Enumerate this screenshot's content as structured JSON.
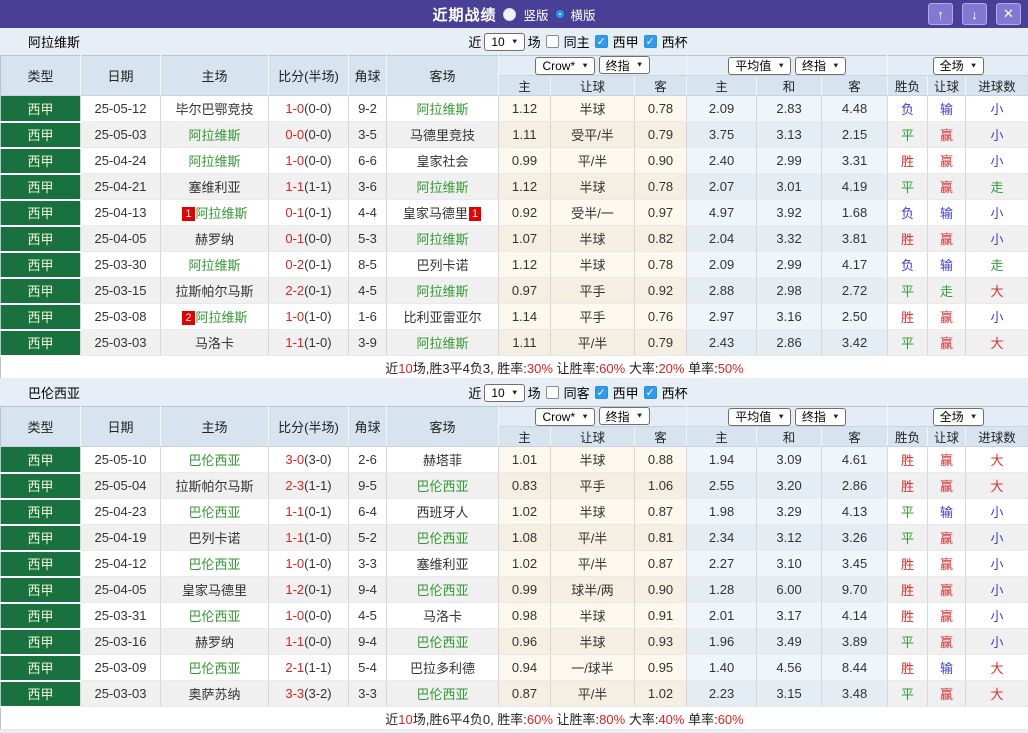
{
  "colors": {
    "titlebar_bg": "#4a3f96",
    "window_button_bg": "#8478d2",
    "league_cell_green": "#18713e",
    "team_link_green": "#339933",
    "score_red": "#dd2222",
    "result_win_red": "#d93030",
    "result_draw_green": "#2f9e36",
    "result_lose_blue": "#3d3dd1",
    "checkbox_checked_blue": "#2d9ced",
    "header_bg": "#d8e3f0"
  },
  "icons": {
    "up": "↑",
    "down": "↓",
    "close": "✕",
    "caret": "▼"
  },
  "titlebar": {
    "title": "近期战绩",
    "radio_vertical": "竖版",
    "radio_vertical_state": "filled",
    "radio_horizontal": "横版",
    "radio_horizontal_state": "ring"
  },
  "table_header": {
    "cols": [
      "类型",
      "日期",
      "主场",
      "比分(半场)",
      "角球",
      "客场"
    ],
    "sub": [
      "主",
      "让球",
      "客",
      "主",
      "和",
      "客",
      "胜负",
      "让球",
      "进球数"
    ]
  },
  "sections": [
    {
      "team": "阿拉维斯",
      "filter": {
        "near_label": "近",
        "count": "10",
        "games_label": "场",
        "same_label": "同主",
        "same_state": "unchecked",
        "league_label": "西甲",
        "league_state": "checked",
        "cup_label": "西杯",
        "cup_state": "checked"
      },
      "dropdowns": {
        "asian_source": "Crow*",
        "asian_kind": "终指",
        "euro_source": "平均值",
        "euro_kind": "终指",
        "scope": "全场"
      },
      "rows": [
        {
          "league": "西甲",
          "date": "25-05-12",
          "home": "毕尔巴鄂竞技",
          "home_cls": "",
          "home_badge": "",
          "ft": "1-0",
          "ht": "(0-0)",
          "corner": "9-2",
          "away": "阿拉维斯",
          "away_cls": "team-green",
          "away_badge": "",
          "ah_home": "1.12",
          "ah_line": "半球",
          "ah_away": "0.78",
          "eu_home": "2.09",
          "eu_draw": "2.83",
          "eu_away": "4.48",
          "r1": "负",
          "r1c": "c-blue",
          "r2": "输",
          "r2c": "c-blue",
          "r3": "小",
          "r3c": "c-blue"
        },
        {
          "league": "西甲",
          "date": "25-05-03",
          "home": "阿拉维斯",
          "home_cls": "team-green",
          "home_badge": "",
          "ft": "0-0",
          "ht": "(0-0)",
          "corner": "3-5",
          "away": "马德里竞技",
          "away_cls": "",
          "away_badge": "",
          "ah_home": "1.11",
          "ah_line": "受平/半",
          "ah_away": "0.79",
          "eu_home": "3.75",
          "eu_draw": "3.13",
          "eu_away": "2.15",
          "r1": "平",
          "r1c": "c-green",
          "r2": "赢",
          "r2c": "c-red",
          "r3": "小",
          "r3c": "c-blue"
        },
        {
          "league": "西甲",
          "date": "25-04-24",
          "home": "阿拉维斯",
          "home_cls": "team-green",
          "home_badge": "",
          "ft": "1-0",
          "ht": "(0-0)",
          "corner": "6-6",
          "away": "皇家社会",
          "away_cls": "",
          "away_badge": "",
          "ah_home": "0.99",
          "ah_line": "平/半",
          "ah_away": "0.90",
          "eu_home": "2.40",
          "eu_draw": "2.99",
          "eu_away": "3.31",
          "r1": "胜",
          "r1c": "c-red",
          "r2": "赢",
          "r2c": "c-red",
          "r3": "小",
          "r3c": "c-blue"
        },
        {
          "league": "西甲",
          "date": "25-04-21",
          "home": "塞维利亚",
          "home_cls": "",
          "home_badge": "",
          "ft": "1-1",
          "ht": "(1-1)",
          "corner": "3-6",
          "away": "阿拉维斯",
          "away_cls": "team-green",
          "away_badge": "",
          "ah_home": "1.12",
          "ah_line": "半球",
          "ah_away": "0.78",
          "eu_home": "2.07",
          "eu_draw": "3.01",
          "eu_away": "4.19",
          "r1": "平",
          "r1c": "c-green",
          "r2": "赢",
          "r2c": "c-red",
          "r3": "走",
          "r3c": "c-green"
        },
        {
          "league": "西甲",
          "date": "25-04-13",
          "home": "阿拉维斯",
          "home_cls": "team-green",
          "home_badge": "1",
          "ft": "0-1",
          "ht": "(0-1)",
          "corner": "4-4",
          "away": "皇家马德里",
          "away_cls": "",
          "away_badge": "1",
          "ah_home": "0.92",
          "ah_line": "受半/一",
          "ah_away": "0.97",
          "eu_home": "4.97",
          "eu_draw": "3.92",
          "eu_away": "1.68",
          "r1": "负",
          "r1c": "c-blue",
          "r2": "输",
          "r2c": "c-blue",
          "r3": "小",
          "r3c": "c-blue"
        },
        {
          "league": "西甲",
          "date": "25-04-05",
          "home": "赫罗纳",
          "home_cls": "",
          "home_badge": "",
          "ft": "0-1",
          "ht": "(0-0)",
          "corner": "5-3",
          "away": "阿拉维斯",
          "away_cls": "team-green",
          "away_badge": "",
          "ah_home": "1.07",
          "ah_line": "半球",
          "ah_away": "0.82",
          "eu_home": "2.04",
          "eu_draw": "3.32",
          "eu_away": "3.81",
          "r1": "胜",
          "r1c": "c-red",
          "r2": "赢",
          "r2c": "c-red",
          "r3": "小",
          "r3c": "c-blue"
        },
        {
          "league": "西甲",
          "date": "25-03-30",
          "home": "阿拉维斯",
          "home_cls": "team-green",
          "home_badge": "",
          "ft": "0-2",
          "ht": "(0-1)",
          "corner": "8-5",
          "away": "巴列卡诺",
          "away_cls": "",
          "away_badge": "",
          "ah_home": "1.12",
          "ah_line": "半球",
          "ah_away": "0.78",
          "eu_home": "2.09",
          "eu_draw": "2.99",
          "eu_away": "4.17",
          "r1": "负",
          "r1c": "c-blue",
          "r2": "输",
          "r2c": "c-blue",
          "r3": "走",
          "r3c": "c-green"
        },
        {
          "league": "西甲",
          "date": "25-03-15",
          "home": "拉斯帕尔马斯",
          "home_cls": "",
          "home_badge": "",
          "ft": "2-2",
          "ht": "(0-1)",
          "corner": "4-5",
          "away": "阿拉维斯",
          "away_cls": "team-green",
          "away_badge": "",
          "ah_home": "0.97",
          "ah_line": "平手",
          "ah_away": "0.92",
          "eu_home": "2.88",
          "eu_draw": "2.98",
          "eu_away": "2.72",
          "r1": "平",
          "r1c": "c-green",
          "r2": "走",
          "r2c": "c-green",
          "r3": "大",
          "r3c": "c-red"
        },
        {
          "league": "西甲",
          "date": "25-03-08",
          "home": "阿拉维斯",
          "home_cls": "team-green",
          "home_badge": "2",
          "ft": "1-0",
          "ht": "(1-0)",
          "corner": "1-6",
          "away": "比利亚雷亚尔",
          "away_cls": "",
          "away_badge": "",
          "ah_home": "1.14",
          "ah_line": "平手",
          "ah_away": "0.76",
          "eu_home": "2.97",
          "eu_draw": "3.16",
          "eu_away": "2.50",
          "r1": "胜",
          "r1c": "c-red",
          "r2": "赢",
          "r2c": "c-red",
          "r3": "小",
          "r3c": "c-blue"
        },
        {
          "league": "西甲",
          "date": "25-03-03",
          "home": "马洛卡",
          "home_cls": "",
          "home_badge": "",
          "ft": "1-1",
          "ht": "(1-0)",
          "corner": "3-9",
          "away": "阿拉维斯",
          "away_cls": "team-green",
          "away_badge": "",
          "ah_home": "1.11",
          "ah_line": "平/半",
          "ah_away": "0.79",
          "eu_home": "2.43",
          "eu_draw": "2.86",
          "eu_away": "3.42",
          "r1": "平",
          "r1c": "c-green",
          "r2": "赢",
          "r2c": "c-red",
          "r3": "大",
          "r3c": "c-red"
        }
      ],
      "summary": {
        "p1": "近",
        "n": "10",
        "p2": "场,胜3平4负3, 胜率:",
        "v1": "30%",
        "p3": " 让胜率:",
        "v2": "60%",
        "p4": " 大率:",
        "v3": "20%",
        "p5": " 单率:",
        "v4": "50%"
      }
    },
    {
      "team": "巴伦西亚",
      "filter": {
        "near_label": "近",
        "count": "10",
        "games_label": "场",
        "same_label": "同客",
        "same_state": "unchecked",
        "league_label": "西甲",
        "league_state": "checked",
        "cup_label": "西杯",
        "cup_state": "checked"
      },
      "dropdowns": {
        "asian_source": "Crow*",
        "asian_kind": "终指",
        "euro_source": "平均值",
        "euro_kind": "终指",
        "scope": "全场"
      },
      "rows": [
        {
          "league": "西甲",
          "date": "25-05-10",
          "home": "巴伦西亚",
          "home_cls": "team-green",
          "home_badge": "",
          "ft": "3-0",
          "ht": "(3-0)",
          "corner": "2-6",
          "away": "赫塔菲",
          "away_cls": "",
          "away_badge": "",
          "ah_home": "1.01",
          "ah_line": "半球",
          "ah_away": "0.88",
          "eu_home": "1.94",
          "eu_draw": "3.09",
          "eu_away": "4.61",
          "r1": "胜",
          "r1c": "c-red",
          "r2": "赢",
          "r2c": "c-red",
          "r3": "大",
          "r3c": "c-red"
        },
        {
          "league": "西甲",
          "date": "25-05-04",
          "home": "拉斯帕尔马斯",
          "home_cls": "",
          "home_badge": "",
          "ft": "2-3",
          "ht": "(1-1)",
          "corner": "9-5",
          "away": "巴伦西亚",
          "away_cls": "team-green",
          "away_badge": "",
          "ah_home": "0.83",
          "ah_line": "平手",
          "ah_away": "1.06",
          "eu_home": "2.55",
          "eu_draw": "3.20",
          "eu_away": "2.86",
          "r1": "胜",
          "r1c": "c-red",
          "r2": "赢",
          "r2c": "c-red",
          "r3": "大",
          "r3c": "c-red"
        },
        {
          "league": "西甲",
          "date": "25-04-23",
          "home": "巴伦西亚",
          "home_cls": "team-green",
          "home_badge": "",
          "ft": "1-1",
          "ht": "(0-1)",
          "corner": "6-4",
          "away": "西班牙人",
          "away_cls": "",
          "away_badge": "",
          "ah_home": "1.02",
          "ah_line": "半球",
          "ah_away": "0.87",
          "eu_home": "1.98",
          "eu_draw": "3.29",
          "eu_away": "4.13",
          "r1": "平",
          "r1c": "c-green",
          "r2": "输",
          "r2c": "c-blue",
          "r3": "小",
          "r3c": "c-blue"
        },
        {
          "league": "西甲",
          "date": "25-04-19",
          "home": "巴列卡诺",
          "home_cls": "",
          "home_badge": "",
          "ft": "1-1",
          "ht": "(1-0)",
          "corner": "5-2",
          "away": "巴伦西亚",
          "away_cls": "team-green",
          "away_badge": "",
          "ah_home": "1.08",
          "ah_line": "平/半",
          "ah_away": "0.81",
          "eu_home": "2.34",
          "eu_draw": "3.12",
          "eu_away": "3.26",
          "r1": "平",
          "r1c": "c-green",
          "r2": "赢",
          "r2c": "c-red",
          "r3": "小",
          "r3c": "c-blue"
        },
        {
          "league": "西甲",
          "date": "25-04-12",
          "home": "巴伦西亚",
          "home_cls": "team-green",
          "home_badge": "",
          "ft": "1-0",
          "ht": "(1-0)",
          "corner": "3-3",
          "away": "塞维利亚",
          "away_cls": "",
          "away_badge": "",
          "ah_home": "1.02",
          "ah_line": "平/半",
          "ah_away": "0.87",
          "eu_home": "2.27",
          "eu_draw": "3.10",
          "eu_away": "3.45",
          "r1": "胜",
          "r1c": "c-red",
          "r2": "赢",
          "r2c": "c-red",
          "r3": "小",
          "r3c": "c-blue"
        },
        {
          "league": "西甲",
          "date": "25-04-05",
          "home": "皇家马德里",
          "home_cls": "",
          "home_badge": "",
          "ft": "1-2",
          "ht": "(0-1)",
          "corner": "9-4",
          "away": "巴伦西亚",
          "away_cls": "team-green",
          "away_badge": "",
          "ah_home": "0.99",
          "ah_line": "球半/两",
          "ah_away": "0.90",
          "eu_home": "1.28",
          "eu_draw": "6.00",
          "eu_away": "9.70",
          "r1": "胜",
          "r1c": "c-red",
          "r2": "赢",
          "r2c": "c-red",
          "r3": "小",
          "r3c": "c-blue"
        },
        {
          "league": "西甲",
          "date": "25-03-31",
          "home": "巴伦西亚",
          "home_cls": "team-green",
          "home_badge": "",
          "ft": "1-0",
          "ht": "(0-0)",
          "corner": "4-5",
          "away": "马洛卡",
          "away_cls": "",
          "away_badge": "",
          "ah_home": "0.98",
          "ah_line": "半球",
          "ah_away": "0.91",
          "eu_home": "2.01",
          "eu_draw": "3.17",
          "eu_away": "4.14",
          "r1": "胜",
          "r1c": "c-red",
          "r2": "赢",
          "r2c": "c-red",
          "r3": "小",
          "r3c": "c-blue"
        },
        {
          "league": "西甲",
          "date": "25-03-16",
          "home": "赫罗纳",
          "home_cls": "",
          "home_badge": "",
          "ft": "1-1",
          "ht": "(0-0)",
          "corner": "9-4",
          "away": "巴伦西亚",
          "away_cls": "team-green",
          "away_badge": "",
          "ah_home": "0.96",
          "ah_line": "半球",
          "ah_away": "0.93",
          "eu_home": "1.96",
          "eu_draw": "3.49",
          "eu_away": "3.89",
          "r1": "平",
          "r1c": "c-green",
          "r2": "赢",
          "r2c": "c-red",
          "r3": "小",
          "r3c": "c-blue"
        },
        {
          "league": "西甲",
          "date": "25-03-09",
          "home": "巴伦西亚",
          "home_cls": "team-green",
          "home_badge": "",
          "ft": "2-1",
          "ht": "(1-1)",
          "corner": "5-4",
          "away": "巴拉多利德",
          "away_cls": "",
          "away_badge": "",
          "ah_home": "0.94",
          "ah_line": "一/球半",
          "ah_away": "0.95",
          "eu_home": "1.40",
          "eu_draw": "4.56",
          "eu_away": "8.44",
          "r1": "胜",
          "r1c": "c-red",
          "r2": "输",
          "r2c": "c-blue",
          "r3": "大",
          "r3c": "c-red"
        },
        {
          "league": "西甲",
          "date": "25-03-03",
          "home": "奥萨苏纳",
          "home_cls": "",
          "home_badge": "",
          "ft": "3-3",
          "ht": "(3-2)",
          "corner": "3-3",
          "away": "巴伦西亚",
          "away_cls": "team-green",
          "away_badge": "",
          "ah_home": "0.87",
          "ah_line": "平/半",
          "ah_away": "1.02",
          "eu_home": "2.23",
          "eu_draw": "3.15",
          "eu_away": "3.48",
          "r1": "平",
          "r1c": "c-green",
          "r2": "赢",
          "r2c": "c-red",
          "r3": "大",
          "r3c": "c-red"
        }
      ],
      "summary": {
        "p1": "近",
        "n": "10",
        "p2": "场,胜6平4负0, 胜率:",
        "v1": "60%",
        "p3": " 让胜率:",
        "v2": "80%",
        "p4": " 大率:",
        "v3": "40%",
        "p5": " 单率:",
        "v4": "60%"
      }
    }
  ]
}
